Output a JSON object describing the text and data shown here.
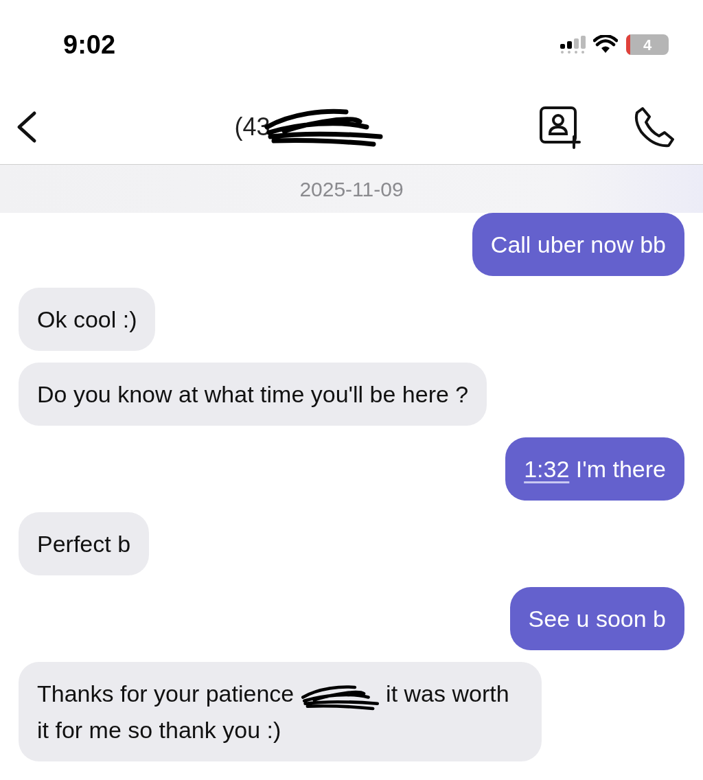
{
  "status_bar": {
    "time": "9:02",
    "battery": "4"
  },
  "header": {
    "title": "(43"
  },
  "date": "2025-11-09",
  "messages": [
    {
      "kind": "sent",
      "segments": [
        {
          "kind": "text",
          "text": "Call uber now bb"
        }
      ]
    },
    {
      "kind": "received",
      "segments": [
        {
          "kind": "text",
          "text": "Ok cool :)"
        }
      ]
    },
    {
      "kind": "received",
      "segments": [
        {
          "kind": "text",
          "text": "Do you know at what time you'll be here ?"
        }
      ]
    },
    {
      "kind": "sent",
      "segments": [
        {
          "kind": "link",
          "text": "1:32"
        },
        {
          "kind": "text",
          "text": "I'm there"
        }
      ]
    },
    {
      "kind": "received",
      "segments": [
        {
          "kind": "text",
          "text": "Perfect b"
        }
      ]
    },
    {
      "kind": "sent",
      "segments": [
        {
          "kind": "text",
          "text": "See u soon b"
        }
      ]
    },
    {
      "kind": "received",
      "segments": [
        {
          "kind": "text",
          "text": "Thanks for your patience"
        },
        {
          "kind": "redacted"
        },
        {
          "kind": "text",
          "text": "it was worth it for me so thank you :)"
        }
      ]
    }
  ]
}
